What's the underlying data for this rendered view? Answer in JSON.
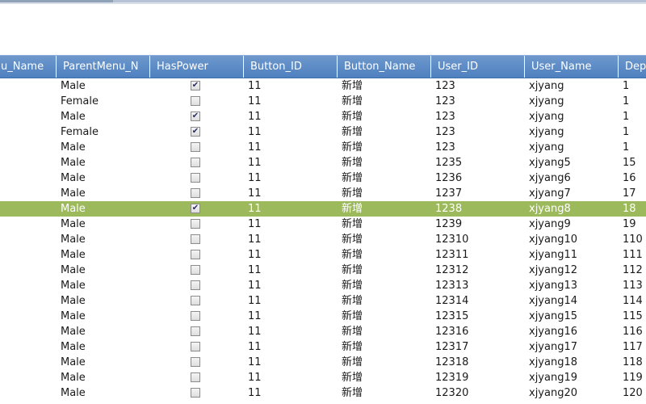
{
  "grid": {
    "columns": [
      {
        "key": "menu_name",
        "label": "u_Name"
      },
      {
        "key": "parent_menu",
        "label": "ParentMenu_N"
      },
      {
        "key": "has_power",
        "label": "HasPower"
      },
      {
        "key": "button_id",
        "label": "Button_ID"
      },
      {
        "key": "button_name",
        "label": "Button_Name"
      },
      {
        "key": "user_id",
        "label": "User_ID"
      },
      {
        "key": "user_name",
        "label": "User_Name"
      },
      {
        "key": "dept",
        "label": "Dep"
      }
    ],
    "selected_row": 8,
    "rows": [
      {
        "parent_menu": "Male",
        "has_power": true,
        "button_id": "11",
        "button_name": "新增",
        "user_id": "123",
        "user_name": "xjyang",
        "dept": "1"
      },
      {
        "parent_menu": "Female",
        "has_power": false,
        "button_id": "11",
        "button_name": "新增",
        "user_id": "123",
        "user_name": "xjyang",
        "dept": "1"
      },
      {
        "parent_menu": "Male",
        "has_power": true,
        "button_id": "11",
        "button_name": "新增",
        "user_id": "123",
        "user_name": "xjyang",
        "dept": "1"
      },
      {
        "parent_menu": "Female",
        "has_power": true,
        "button_id": "11",
        "button_name": "新增",
        "user_id": "123",
        "user_name": "xjyang",
        "dept": "1"
      },
      {
        "parent_menu": "Male",
        "has_power": false,
        "button_id": "11",
        "button_name": "新增",
        "user_id": "123",
        "user_name": "xjyang",
        "dept": "1"
      },
      {
        "parent_menu": "Male",
        "has_power": false,
        "button_id": "11",
        "button_name": "新增",
        "user_id": "1235",
        "user_name": "xjyang5",
        "dept": "15"
      },
      {
        "parent_menu": "Male",
        "has_power": false,
        "button_id": "11",
        "button_name": "新增",
        "user_id": "1236",
        "user_name": "xjyang6",
        "dept": "16"
      },
      {
        "parent_menu": "Male",
        "has_power": false,
        "button_id": "11",
        "button_name": "新增",
        "user_id": "1237",
        "user_name": "xjyang7",
        "dept": "17"
      },
      {
        "parent_menu": "Male",
        "has_power": true,
        "button_id": "11",
        "button_name": "新增",
        "user_id": "1238",
        "user_name": "xjyang8",
        "dept": "18"
      },
      {
        "parent_menu": "Male",
        "has_power": false,
        "button_id": "11",
        "button_name": "新增",
        "user_id": "1239",
        "user_name": "xjyang9",
        "dept": "19"
      },
      {
        "parent_menu": "Male",
        "has_power": false,
        "button_id": "11",
        "button_name": "新增",
        "user_id": "12310",
        "user_name": "xjyang10",
        "dept": "110"
      },
      {
        "parent_menu": "Male",
        "has_power": false,
        "button_id": "11",
        "button_name": "新增",
        "user_id": "12311",
        "user_name": "xjyang11",
        "dept": "111"
      },
      {
        "parent_menu": "Male",
        "has_power": false,
        "button_id": "11",
        "button_name": "新增",
        "user_id": "12312",
        "user_name": "xjyang12",
        "dept": "112"
      },
      {
        "parent_menu": "Male",
        "has_power": false,
        "button_id": "11",
        "button_name": "新增",
        "user_id": "12313",
        "user_name": "xjyang13",
        "dept": "113"
      },
      {
        "parent_menu": "Male",
        "has_power": false,
        "button_id": "11",
        "button_name": "新增",
        "user_id": "12314",
        "user_name": "xjyang14",
        "dept": "114"
      },
      {
        "parent_menu": "Male",
        "has_power": false,
        "button_id": "11",
        "button_name": "新增",
        "user_id": "12315",
        "user_name": "xjyang15",
        "dept": "115"
      },
      {
        "parent_menu": "Male",
        "has_power": false,
        "button_id": "11",
        "button_name": "新增",
        "user_id": "12316",
        "user_name": "xjyang16",
        "dept": "116"
      },
      {
        "parent_menu": "Male",
        "has_power": false,
        "button_id": "11",
        "button_name": "新增",
        "user_id": "12317",
        "user_name": "xjyang17",
        "dept": "117"
      },
      {
        "parent_menu": "Male",
        "has_power": false,
        "button_id": "11",
        "button_name": "新增",
        "user_id": "12318",
        "user_name": "xjyang18",
        "dept": "118"
      },
      {
        "parent_menu": "Male",
        "has_power": false,
        "button_id": "11",
        "button_name": "新增",
        "user_id": "12319",
        "user_name": "xjyang19",
        "dept": "119"
      },
      {
        "parent_menu": "Male",
        "has_power": false,
        "button_id": "11",
        "button_name": "新增",
        "user_id": "12320",
        "user_name": "xjyang20",
        "dept": "120"
      }
    ]
  },
  "colors": {
    "header_bg": "#5f8dc7",
    "selected_row_bg": "#9cba5b",
    "text": "#1a1a1a"
  }
}
